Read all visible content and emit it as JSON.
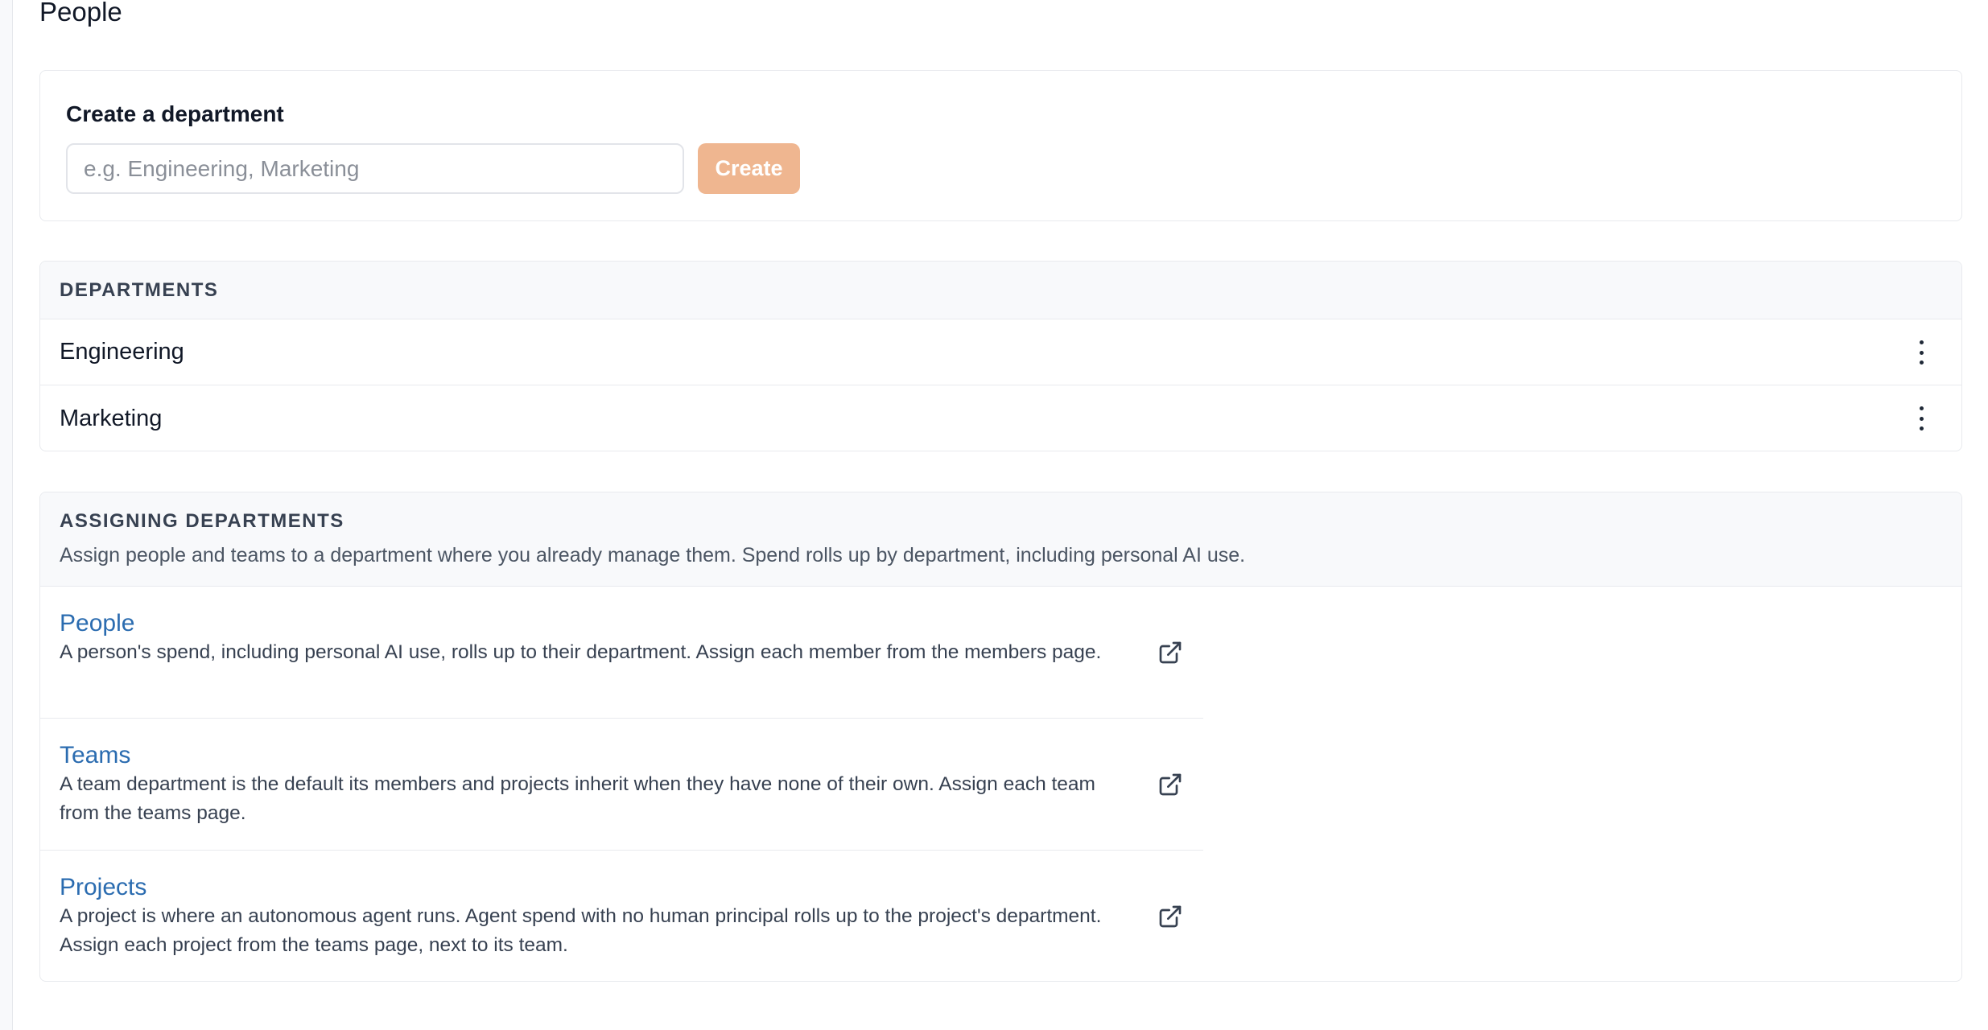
{
  "page": {
    "title": "People"
  },
  "create_department": {
    "title": "Create a department",
    "input_value": "",
    "input_placeholder": "e.g. Engineering, Marketing",
    "button_label": "Create"
  },
  "departments": {
    "heading": "DEPARTMENTS",
    "items": [
      {
        "name": "Engineering",
        "menu_icon": "more-vertical-icon"
      },
      {
        "name": "Marketing",
        "menu_icon": "more-vertical-icon"
      }
    ]
  },
  "assigning": {
    "heading": "ASSIGNING DEPARTMENTS",
    "description": "Assign people and teams to a department where you already manage them. Spend rolls up by department, including personal AI use.",
    "items": [
      {
        "label": "People",
        "text": "A person's spend, including personal AI use, rolls up to their department. Assign each member from the members page.",
        "icon": "external-link-icon"
      },
      {
        "label": "Teams",
        "text": "A team department is the default its members and projects inherit when they have none of their own. Assign each team from the teams page.",
        "icon": "external-link-icon"
      },
      {
        "label": "Projects",
        "text": "A project is where an autonomous agent runs. Agent spend with no human principal rolls up to the project's department. Assign each project from the teams page, next to its team.",
        "icon": "external-link-icon"
      }
    ]
  },
  "colors": {
    "accent_button": "#efb690",
    "link": "#2b6cb0",
    "section_header_bg": "#f8f9fb",
    "border": "#e8eaee"
  }
}
